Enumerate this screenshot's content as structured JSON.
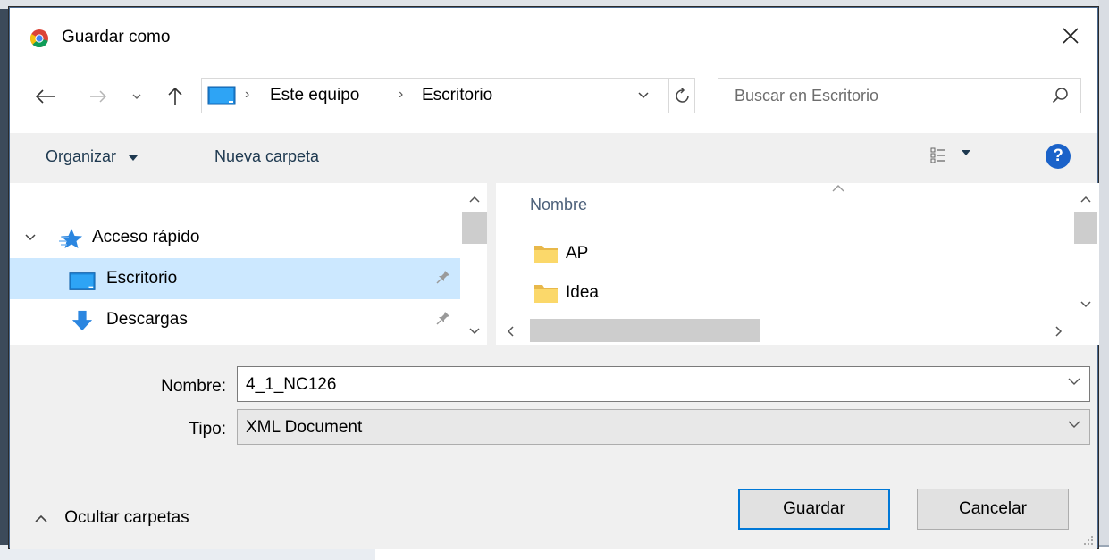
{
  "window": {
    "title": "Guardar como",
    "close_icon": "close-icon"
  },
  "navigation": {
    "breadcrumb": [
      "Este equipo",
      "Escritorio"
    ],
    "search_placeholder": "Buscar en Escritorio"
  },
  "toolbar": {
    "organize_label": "Organizar",
    "new_folder_label": "Nueva carpeta",
    "help_label": "?"
  },
  "sidebar": {
    "items": [
      {
        "label": "Acceso rápido",
        "icon": "star-icon"
      },
      {
        "label": "Escritorio",
        "icon": "desktop-icon",
        "selected": true,
        "pinned": true
      },
      {
        "label": "Descargas",
        "icon": "download-icon",
        "pinned": true
      }
    ]
  },
  "file_list": {
    "column_header": "Nombre",
    "items": [
      {
        "name": "AP",
        "icon": "folder-icon"
      },
      {
        "name": "Idea",
        "icon": "folder-icon"
      }
    ]
  },
  "form": {
    "name_label": "Nombre:",
    "name_value": "4_1_NC126",
    "type_label": "Tipo:",
    "type_value": "XML Document"
  },
  "footer": {
    "hide_folders_label": "Ocultar carpetas",
    "save_label": "Guardar",
    "cancel_label": "Cancelar"
  },
  "colors": {
    "accent": "#0078d7",
    "selection": "#cce8ff",
    "help": "#1a62c9"
  }
}
